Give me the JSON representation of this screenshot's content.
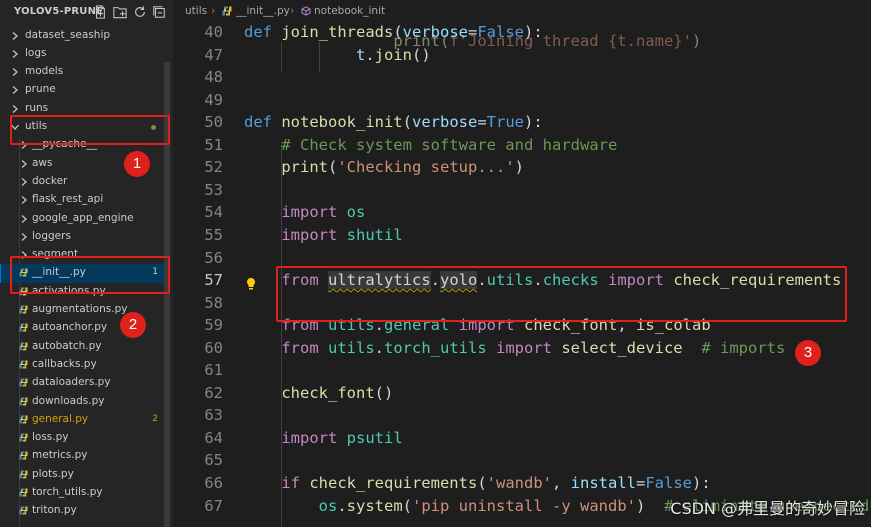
{
  "explorer": {
    "title": "YOLOV5-PRUNE",
    "actions": [
      "new-file-icon",
      "new-folder-icon",
      "refresh-icon",
      "collapse-all-icon"
    ],
    "items": [
      {
        "label": "dataset_seaship",
        "type": "folder",
        "expanded": false
      },
      {
        "label": "logs",
        "type": "folder",
        "expanded": false
      },
      {
        "label": "models",
        "type": "folder",
        "expanded": false
      },
      {
        "label": "prune",
        "type": "folder",
        "expanded": false
      },
      {
        "label": "runs",
        "type": "folder",
        "expanded": false
      },
      {
        "label": "utils",
        "type": "folder",
        "expanded": true,
        "modified_dot": true
      },
      {
        "label": "__pycache__",
        "type": "folder",
        "expanded": false
      },
      {
        "label": "aws",
        "type": "folder",
        "expanded": false
      },
      {
        "label": "docker",
        "type": "folder",
        "expanded": false
      },
      {
        "label": "flask_rest_api",
        "type": "folder",
        "expanded": false
      },
      {
        "label": "google_app_engine",
        "type": "folder",
        "expanded": false
      },
      {
        "label": "loggers",
        "type": "folder",
        "expanded": false
      },
      {
        "label": "segment",
        "type": "folder",
        "expanded": false
      },
      {
        "label": "__init__.py",
        "type": "file",
        "active": true,
        "badge": "1"
      },
      {
        "label": "activations.py",
        "type": "file"
      },
      {
        "label": "augmentations.py",
        "type": "file"
      },
      {
        "label": "autoanchor.py",
        "type": "file"
      },
      {
        "label": "autobatch.py",
        "type": "file"
      },
      {
        "label": "callbacks.py",
        "type": "file"
      },
      {
        "label": "dataloaders.py",
        "type": "file"
      },
      {
        "label": "downloads.py",
        "type": "file"
      },
      {
        "label": "general.py",
        "type": "file",
        "modified": true,
        "badge": "2"
      },
      {
        "label": "loss.py",
        "type": "file"
      },
      {
        "label": "metrics.py",
        "type": "file"
      },
      {
        "label": "plots.py",
        "type": "file"
      },
      {
        "label": "torch_utils.py",
        "type": "file"
      },
      {
        "label": "triton.py",
        "type": "file"
      }
    ]
  },
  "breadcrumb": {
    "parts": [
      "utils",
      "__init__.py",
      "notebook_init"
    ],
    "separator": "›"
  },
  "code": {
    "current_line": 57,
    "lines": [
      {
        "n": "40",
        "tokens": [
          [
            "kw",
            "def "
          ],
          [
            "fn",
            "join_threads"
          ],
          [
            "def",
            "("
          ],
          [
            "var",
            "verbose"
          ],
          [
            "def",
            "="
          ],
          [
            "kw",
            "False"
          ],
          [
            "def",
            "):"
          ]
        ]
      },
      {
        "n": "47",
        "tokens": [
          [
            "def",
            "            "
          ],
          [
            "var",
            "t"
          ],
          [
            "def",
            "."
          ],
          [
            "fn",
            "join"
          ],
          [
            "def",
            "()"
          ]
        ]
      },
      {
        "n": "48",
        "tokens": []
      },
      {
        "n": "49",
        "tokens": []
      },
      {
        "n": "50",
        "tokens": [
          [
            "kw",
            "def "
          ],
          [
            "fn",
            "notebook_init"
          ],
          [
            "def",
            "("
          ],
          [
            "var",
            "verbose"
          ],
          [
            "def",
            "="
          ],
          [
            "kw",
            "True"
          ],
          [
            "def",
            "):"
          ]
        ]
      },
      {
        "n": "51",
        "tokens": [
          [
            "def",
            "    "
          ],
          [
            "cmt",
            "# Check system software and hardware"
          ]
        ]
      },
      {
        "n": "52",
        "tokens": [
          [
            "def",
            "    "
          ],
          [
            "fn",
            "print"
          ],
          [
            "def",
            "("
          ],
          [
            "str",
            "'Checking setup...'"
          ],
          [
            "def",
            ")"
          ]
        ]
      },
      {
        "n": "53",
        "tokens": []
      },
      {
        "n": "54",
        "tokens": [
          [
            "def",
            "    "
          ],
          [
            "kwc",
            "import "
          ],
          [
            "cls",
            "os"
          ]
        ]
      },
      {
        "n": "55",
        "tokens": [
          [
            "def",
            "    "
          ],
          [
            "kwc",
            "import "
          ],
          [
            "cls",
            "shutil"
          ]
        ]
      },
      {
        "n": "56",
        "tokens": []
      },
      {
        "n": "57",
        "tokens": [
          [
            "def",
            "    "
          ],
          [
            "kwc",
            "from "
          ],
          [
            "modsq",
            "ultralytics"
          ],
          [
            "def",
            "."
          ],
          [
            "modsq",
            "yolo"
          ],
          [
            "def",
            "."
          ],
          [
            "cls",
            "utils"
          ],
          [
            "def",
            "."
          ],
          [
            "cls",
            "checks "
          ],
          [
            "kwc",
            "import "
          ],
          [
            "fn",
            "check_requirements"
          ]
        ]
      },
      {
        "n": "58",
        "tokens": []
      },
      {
        "n": "59",
        "tokens": [
          [
            "def",
            "    "
          ],
          [
            "kwc",
            "from "
          ],
          [
            "cls",
            "utils"
          ],
          [
            "def",
            "."
          ],
          [
            "cls",
            "general "
          ],
          [
            "kwc",
            "import "
          ],
          [
            "fn",
            "check_font"
          ],
          [
            "def",
            ", "
          ],
          [
            "fn",
            "is_colab"
          ]
        ]
      },
      {
        "n": "60",
        "tokens": [
          [
            "def",
            "    "
          ],
          [
            "kwc",
            "from "
          ],
          [
            "cls",
            "utils"
          ],
          [
            "def",
            "."
          ],
          [
            "cls",
            "torch_utils "
          ],
          [
            "kwc",
            "import "
          ],
          [
            "fn",
            "select_device"
          ],
          [
            "def",
            "  "
          ],
          [
            "cmt",
            "# imports"
          ]
        ]
      },
      {
        "n": "61",
        "tokens": []
      },
      {
        "n": "62",
        "tokens": [
          [
            "def",
            "    "
          ],
          [
            "fn",
            "check_font"
          ],
          [
            "def",
            "()"
          ]
        ]
      },
      {
        "n": "63",
        "tokens": []
      },
      {
        "n": "64",
        "tokens": [
          [
            "def",
            "    "
          ],
          [
            "kwc",
            "import "
          ],
          [
            "cls",
            "psutil"
          ]
        ]
      },
      {
        "n": "65",
        "tokens": []
      },
      {
        "n": "66",
        "tokens": [
          [
            "def",
            "    "
          ],
          [
            "kwc",
            "if "
          ],
          [
            "fn",
            "check_requirements"
          ],
          [
            "def",
            "("
          ],
          [
            "str",
            "'wandb'"
          ],
          [
            "def",
            ", "
          ],
          [
            "var",
            "install"
          ],
          [
            "def",
            "="
          ],
          [
            "kw",
            "False"
          ],
          [
            "def",
            "):"
          ]
        ]
      },
      {
        "n": "67",
        "tokens": [
          [
            "def",
            "        "
          ],
          [
            "cls",
            "os"
          ],
          [
            "def",
            "."
          ],
          [
            "fn",
            "system"
          ],
          [
            "def",
            "("
          ],
          [
            "str",
            "'pip uninstall -y wandb'"
          ],
          [
            "def",
            ")  "
          ],
          [
            "cmt",
            "# eliminate unexpected a"
          ]
        ]
      }
    ],
    "partial_line": {
      "tokens": [
        [
          "def",
          "                "
        ],
        [
          "fn",
          "print"
        ],
        [
          "def",
          "("
        ],
        [
          "str",
          "f'Joining thread {t.name}'"
        ],
        [
          "def",
          ")"
        ]
      ]
    }
  },
  "annotations": {
    "badges": [
      "1",
      "2",
      "3"
    ],
    "color": "#e0201a"
  },
  "watermark": "CSDN @弗里曼的奇妙冒险",
  "colors": {
    "keyword": "#569cd6",
    "control": "#c586c0",
    "function": "#dcdcaa",
    "variable": "#9cdcfe",
    "class": "#4ec9b0",
    "string": "#ce9178",
    "comment": "#6a9955",
    "active_row": "#04395e",
    "modified": "#cca700"
  }
}
